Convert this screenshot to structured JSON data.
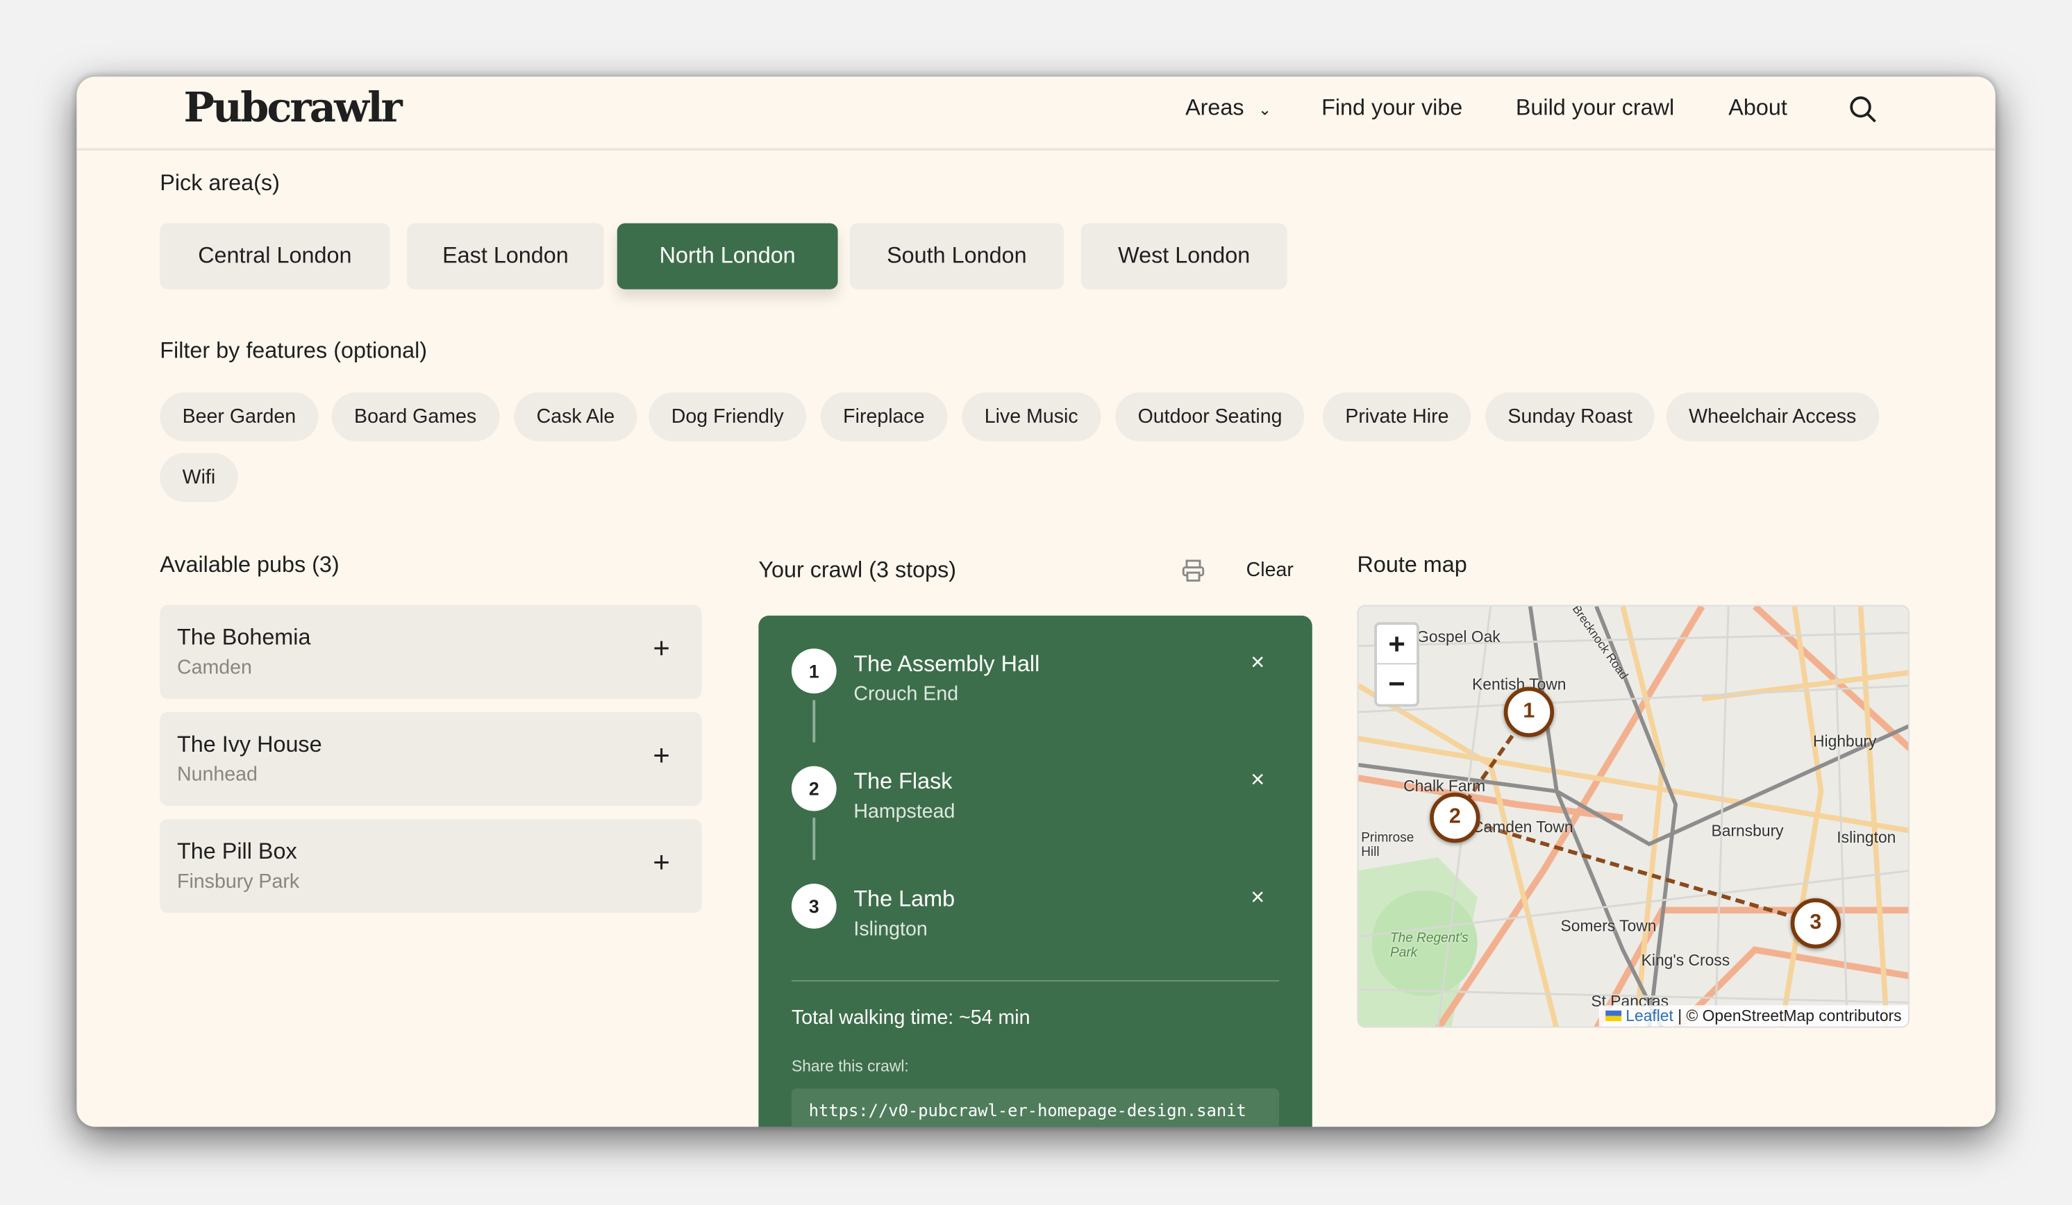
{
  "header": {
    "logo": "Pubcrawlr",
    "nav": [
      "Areas",
      "Find your vibe",
      "Build your crawl",
      "About"
    ]
  },
  "areas": {
    "label": "Pick area(s)",
    "options": [
      "Central London",
      "East London",
      "North London",
      "South London",
      "West London"
    ],
    "selected": "North London"
  },
  "features": {
    "label": "Filter by features (optional)",
    "chips": [
      "Beer Garden",
      "Board Games",
      "Cask Ale",
      "Dog Friendly",
      "Fireplace",
      "Live Music",
      "Outdoor Seating",
      "Private Hire",
      "Sunday Roast",
      "Wheelchair Access",
      "Wifi"
    ]
  },
  "available": {
    "title": "Available pubs (3)",
    "pubs": [
      {
        "name": "The Bohemia",
        "area": "Camden"
      },
      {
        "name": "The Ivy House",
        "area": "Nunhead"
      },
      {
        "name": "The Pill Box",
        "area": "Finsbury Park"
      }
    ],
    "add": "+"
  },
  "crawl": {
    "title": "Your crawl (3 stops)",
    "clear": "Clear",
    "stops": [
      {
        "num": "1",
        "name": "The Assembly Hall",
        "area": "Crouch End"
      },
      {
        "num": "2",
        "name": "The Flask",
        "area": "Hampstead"
      },
      {
        "num": "3",
        "name": "The Lamb",
        "area": "Islington"
      }
    ],
    "remove": "×",
    "total": "Total walking time: ~54 min",
    "share_label": "Share this crawl:",
    "share_url": "https://v0-pubcrawl-er-homepage-design.sanit"
  },
  "map": {
    "title": "Route map",
    "zoom_in": "+",
    "zoom_out": "−",
    "labels": [
      "Gospel Oak",
      "Kentish Town",
      "Highbury",
      "Chalk Farm",
      "Camden Town",
      "Barnsbury",
      "Islington",
      "Primrose Hill",
      "Somers Town",
      "King's Cross",
      "The Regent's Park",
      "St Pancras",
      "Brecknock Road"
    ],
    "attribution_link": "Leaflet",
    "attribution": "| © OpenStreetMap contributors",
    "accent": "#7a3a0c"
  }
}
